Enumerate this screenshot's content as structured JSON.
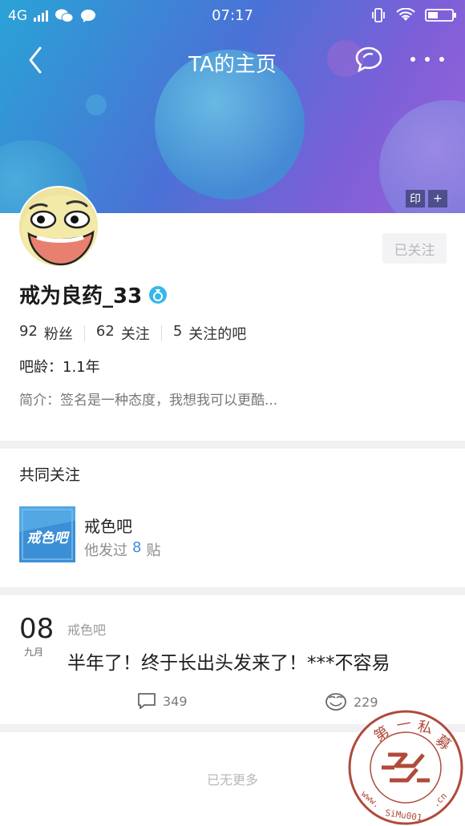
{
  "status_bar": {
    "network": "4G",
    "time": "07:17"
  },
  "nav": {
    "title": "TA的主页",
    "back_icon": "chevron-left-icon",
    "chat_icon": "chat-bubbles-icon",
    "more_icon": "more-dots-icon"
  },
  "header_tags": {
    "stamp_label": "印",
    "add_label": "+"
  },
  "profile": {
    "follow_button": "已关注",
    "username": "戒为良药_33",
    "stats": [
      {
        "count": "92",
        "label": "粉丝"
      },
      {
        "count": "62",
        "label": "关注"
      },
      {
        "count": "5",
        "label": "关注的吧"
      }
    ],
    "bar_age": "吧龄：1.1年",
    "bio": "简介：签名是一种态度，我想我可以更酷..."
  },
  "common_follow": {
    "title": "共同关注",
    "bar_name": "戒色吧",
    "bar_icon_text": "戒色吧",
    "posts_prefix": "他发过",
    "posts_count": "8",
    "posts_suffix": "贴"
  },
  "post": {
    "day": "08",
    "month": "九月",
    "bar_name": "戒色吧",
    "title": "半年了！终于长出头发来了！***不容易",
    "comment_count": "349",
    "like_count": "229"
  },
  "footer": {
    "no_more": "已无更多"
  },
  "watermark": {
    "text_top": "第一私募",
    "text_url": "www.SiMu001.cn"
  },
  "colors": {
    "accent_blue": "#3a8ee6",
    "header_start": "#2aa3d6",
    "header_end": "#9a63d8",
    "seal_red": "#b04a3a"
  }
}
